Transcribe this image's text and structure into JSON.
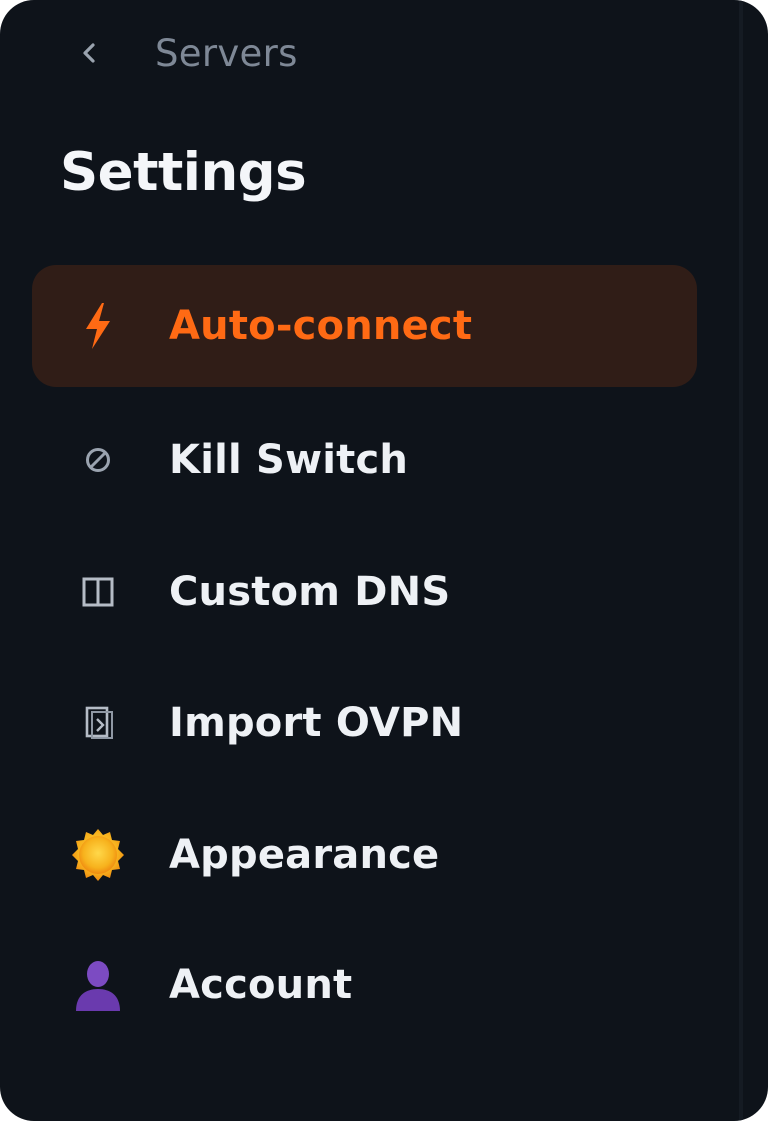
{
  "colors": {
    "background": "#0e131a",
    "active_background": "#301d17",
    "accent": "#ff6a14",
    "text": "#eef1f5",
    "muted": "#7e8896"
  },
  "header": {
    "back_icon": "chevron-left-icon",
    "back_label": "Servers",
    "title": "Settings"
  },
  "menu": {
    "items": [
      {
        "label": "Auto-connect",
        "icon": "lightning-bolt-icon",
        "active": true
      },
      {
        "label": "Kill Switch",
        "icon": "prohibited-icon",
        "active": false
      },
      {
        "label": "Custom DNS",
        "icon": "columns-icon",
        "active": false
      },
      {
        "label": "Import OVPN",
        "icon": "import-file-icon",
        "active": false
      },
      {
        "label": "Appearance",
        "icon": "sun-icon",
        "active": false
      },
      {
        "label": "Account",
        "icon": "user-icon",
        "active": false
      }
    ]
  }
}
